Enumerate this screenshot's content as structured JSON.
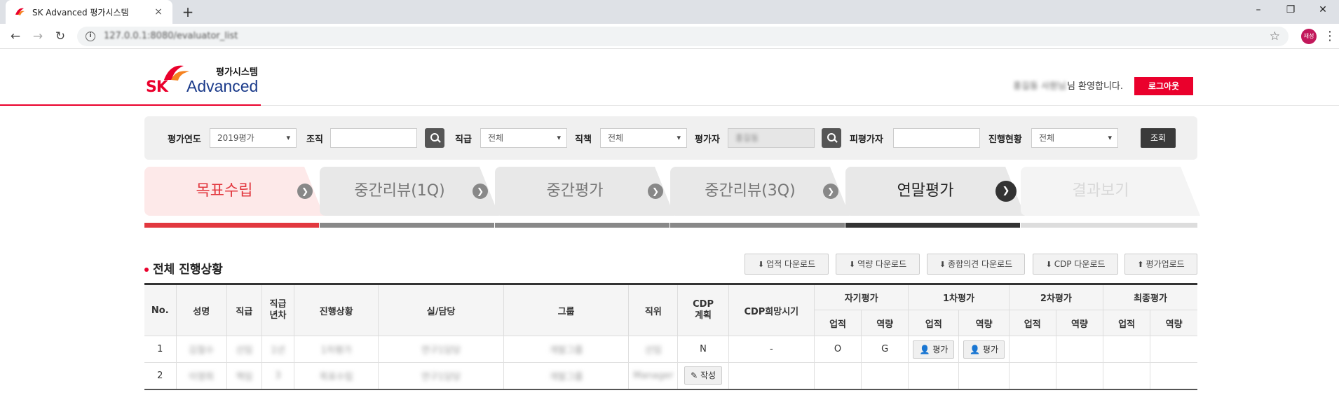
{
  "browser": {
    "tab_title": "SK Advanced 평가시스템",
    "tab_close": "×",
    "new_tab": "+",
    "url": "127.0.0.1:8080/evaluator_list",
    "profile_label": "재성",
    "window_controls": {
      "minimize": "–",
      "restore": "❐",
      "close": "✕"
    },
    "nav": {
      "back": "←",
      "forward": "→",
      "reload": "↻",
      "star": "☆",
      "menu": "⋮"
    }
  },
  "header": {
    "logo": {
      "sk": "SK",
      "advanced": "Advanced",
      "system": "평가시스템"
    },
    "welcome_name": "홍길동 사원님",
    "welcome_text": "님 환영합니다.",
    "logout_label": "로그아웃"
  },
  "search": {
    "year_label": "평가연도",
    "year_value": "2019평가",
    "org_label": "조직",
    "org_value": "",
    "grade_label": "직급",
    "grade_value": "전체",
    "position_label": "직책",
    "position_value": "전체",
    "evaluator_label": "평가자",
    "evaluator_value": "홍길동",
    "evaluatee_label": "피평가자",
    "evaluatee_value": "",
    "status_label": "진행현황",
    "status_value": "전체",
    "query_label": "조회"
  },
  "steps": [
    {
      "label": "목표수립",
      "state": "active"
    },
    {
      "label": "중간리뷰(1Q)",
      "state": "done"
    },
    {
      "label": "중간평가",
      "state": "done"
    },
    {
      "label": "중간리뷰(3Q)",
      "state": "done"
    },
    {
      "label": "연말평가",
      "state": "current"
    },
    {
      "label": "결과보기",
      "state": "disabled"
    }
  ],
  "section": {
    "title": "전체 진행상황",
    "buttons": {
      "perf_download": "업적 다운로드",
      "comp_download": "역량 다운로드",
      "overall_download": "종합의견 다운로드",
      "cdp_download": "CDP 다운로드",
      "eval_upload": "평가업로드"
    }
  },
  "table": {
    "headers": {
      "no": "No.",
      "name": "성명",
      "grade": "직급",
      "grade_year": "직급\n년차",
      "status": "진행상황",
      "dept": "실/담당",
      "group": "그룹",
      "position": "직위",
      "cdp": "CDP\n계획",
      "cdp_time": "CDP희망시기",
      "self": "자기평가",
      "first": "1차평가",
      "second": "2차평가",
      "final": "최종평가",
      "perf": "업적",
      "comp": "역량"
    },
    "rows": [
      {
        "no": "1",
        "name": "김철수",
        "grade": "선임",
        "grade_year": "1년",
        "status": "1차평가",
        "dept": "연구1담당",
        "group": "개발그룹",
        "position": "선임",
        "cdp": "N",
        "cdp_time": "-",
        "self_perf": "O",
        "self_comp": "G",
        "first_perf_btn": "평가",
        "first_comp_btn": "평가"
      },
      {
        "no": "2",
        "name": "이영희",
        "grade": "책임",
        "grade_year": "3",
        "status": "목표수립",
        "dept": "연구1담당",
        "group": "개발그룹",
        "position": "Manager",
        "cdp_btn": "작성"
      }
    ]
  }
}
